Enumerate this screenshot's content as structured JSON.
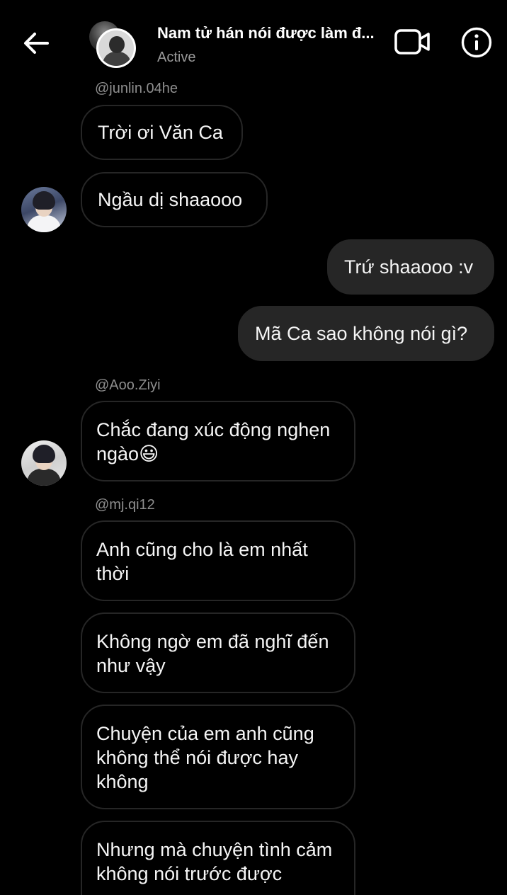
{
  "header": {
    "title": "Nam tử hán nói được làm đ...",
    "status": "Active"
  },
  "messages": [
    {
      "handle": "@junlin.04he",
      "text": "Trời ơi Văn Ca"
    },
    {
      "text": "Ngầu dị shaaooo"
    },
    {
      "text": "Trứ shaaooo :v"
    },
    {
      "text": "Mã Ca sao không nói gì?"
    },
    {
      "handle": "@Aoo.Ziyi",
      "text": "Chắc đang xúc động nghẹn ngào😃"
    },
    {
      "handle": "@mj.qi12",
      "text": "Anh cũng cho là em nhất thời"
    },
    {
      "text": "Không ngờ em đã nghĩ đến như vậy"
    },
    {
      "text": "Chuyện của em anh cũng không thể nói được hay không"
    },
    {
      "text": "Nhưng mà chuyện tình cảm không nói trước được"
    }
  ]
}
